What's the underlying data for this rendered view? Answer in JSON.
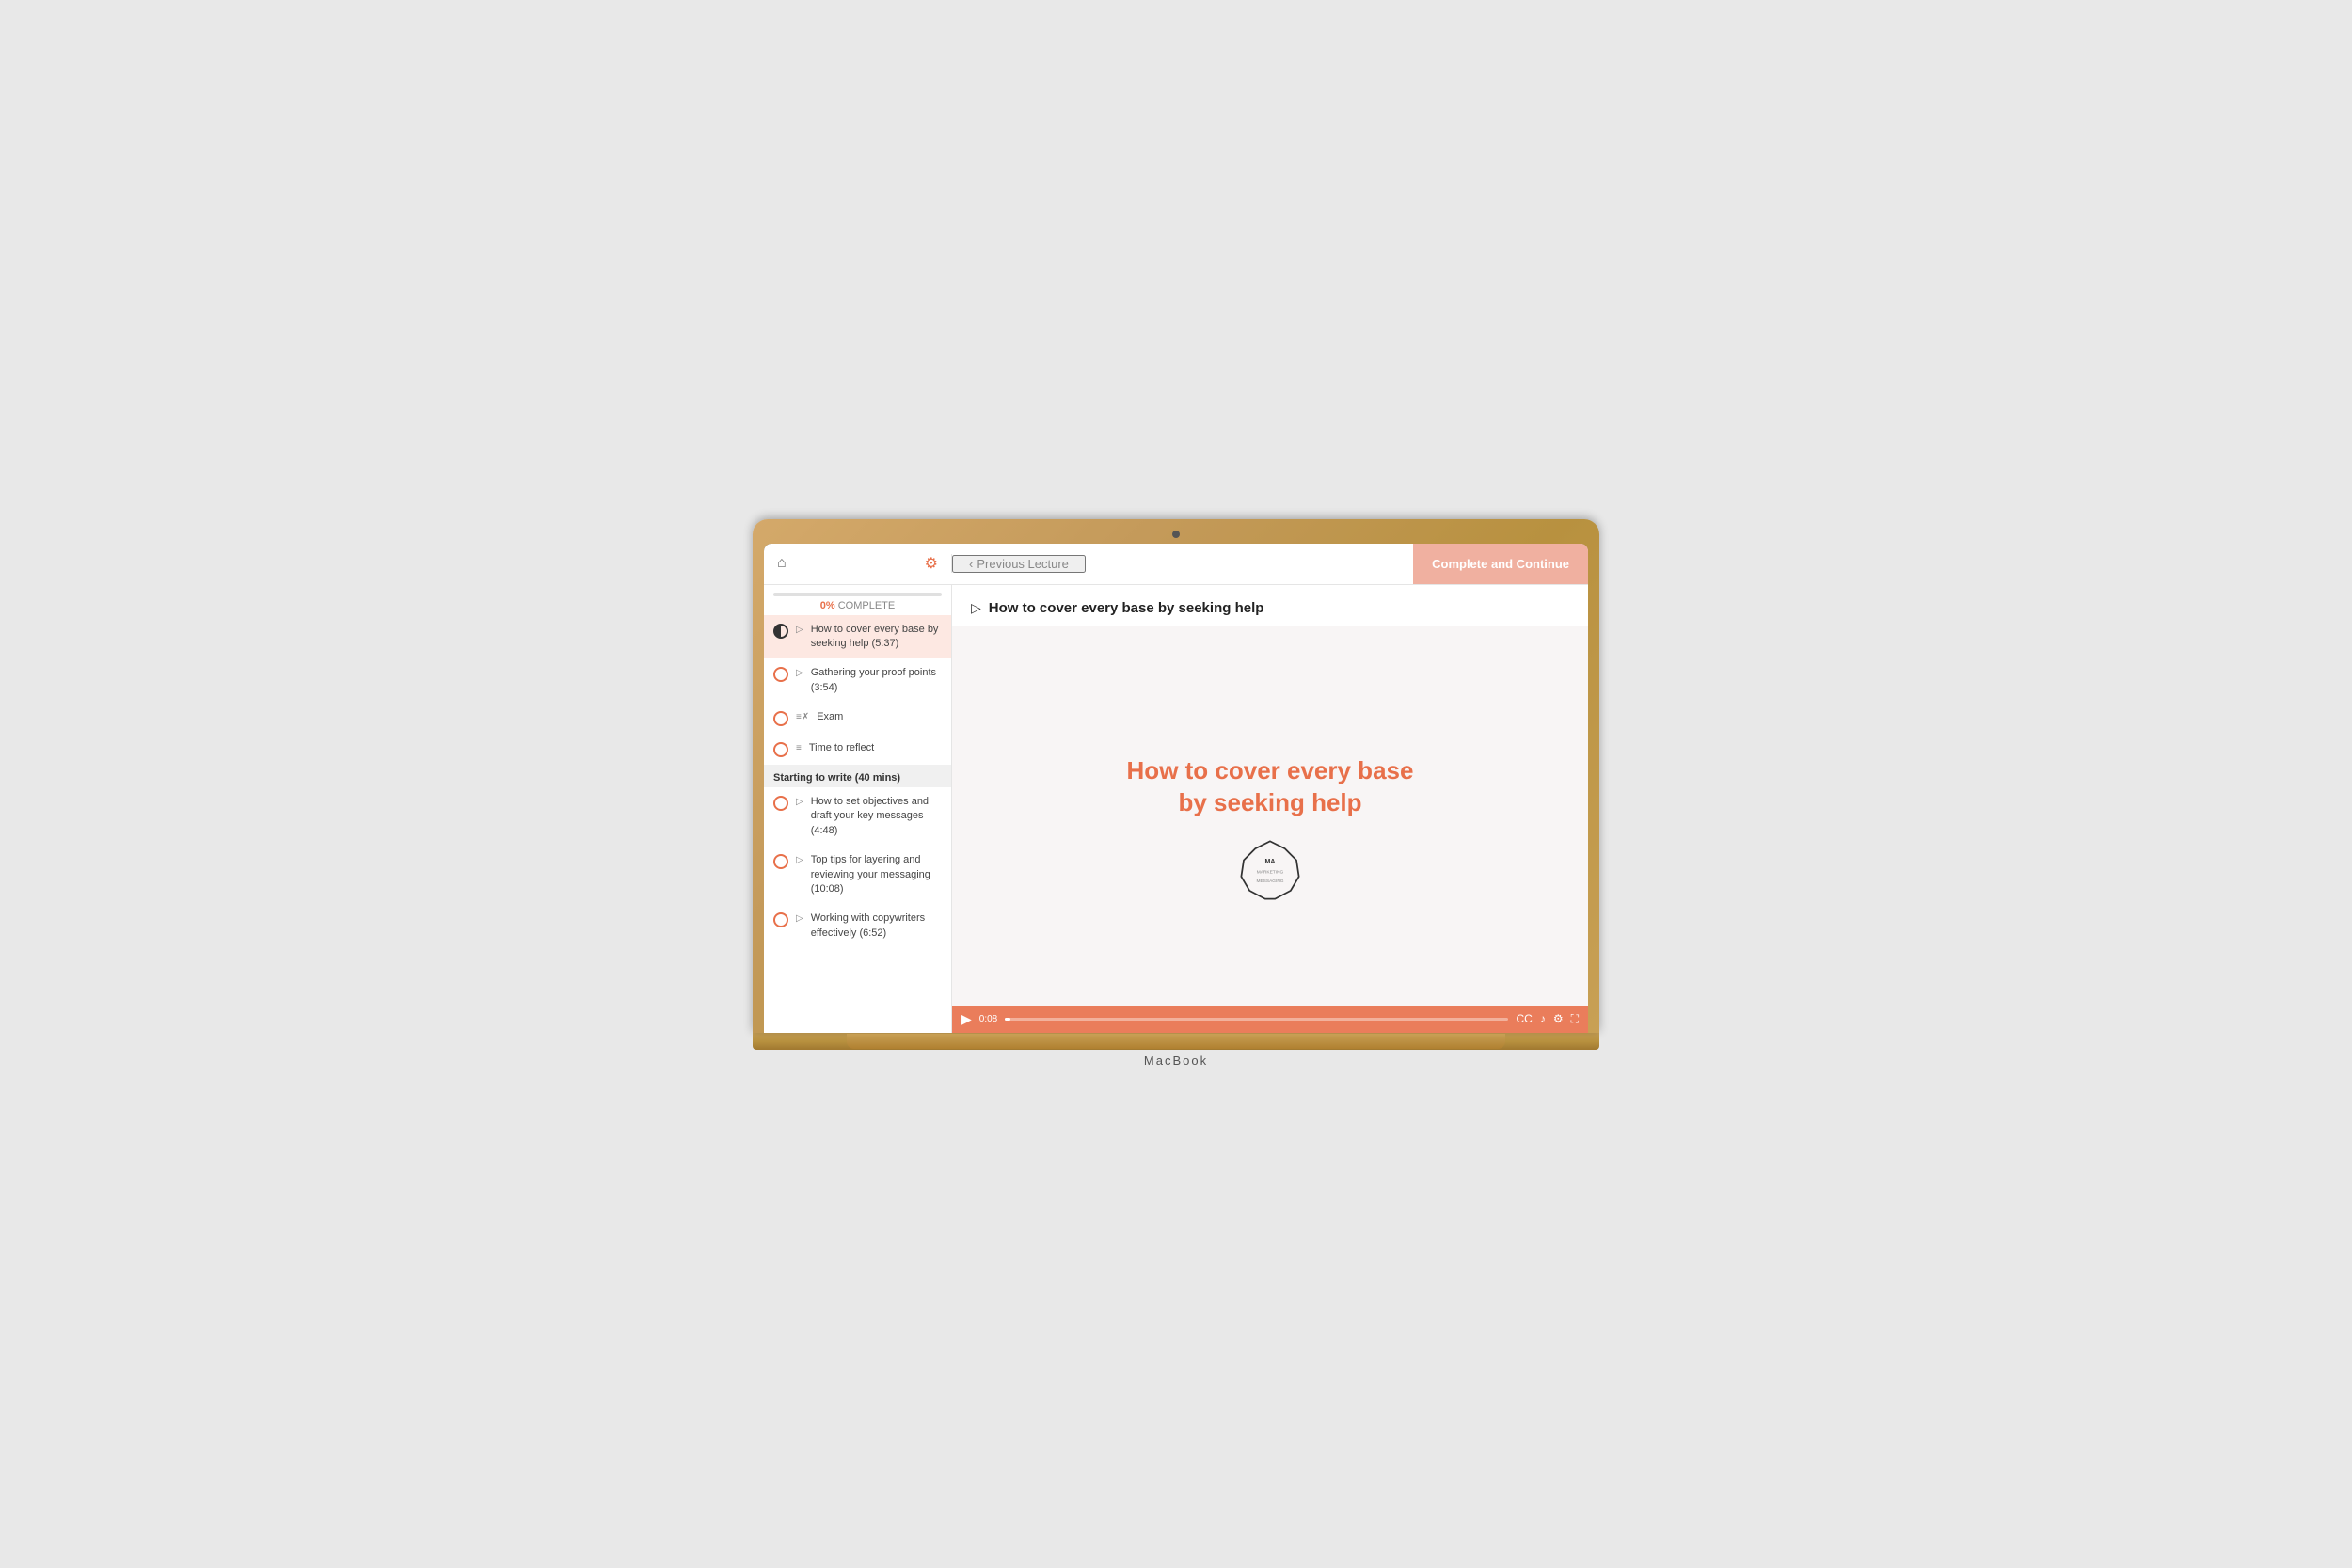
{
  "header": {
    "prev_lecture_label": "Previous Lecture",
    "complete_continue_label": "Complete and Continue"
  },
  "progress": {
    "percentage": "0%",
    "label": "COMPLETE"
  },
  "sidebar": {
    "items": [
      {
        "id": "item-1",
        "icon": "video",
        "text": "How to cover every base by seeking help (5:37)",
        "active": true,
        "circle_type": "half"
      },
      {
        "id": "item-2",
        "icon": "video",
        "text": "Gathering your proof points (3:54)",
        "active": false,
        "circle_type": "empty"
      },
      {
        "id": "item-3",
        "icon": "exam",
        "text": "Exam",
        "active": false,
        "circle_type": "empty"
      },
      {
        "id": "item-4",
        "icon": "text",
        "text": "Time to reflect",
        "active": false,
        "circle_type": "empty"
      }
    ],
    "section_title": "Starting to write (40 mins)",
    "section_items": [
      {
        "id": "section-item-1",
        "icon": "video",
        "text": "How to set objectives and draft your key messages (4:48)",
        "circle_type": "empty"
      },
      {
        "id": "section-item-2",
        "icon": "video",
        "text": "Top tips for layering and reviewing your messaging (10:08)",
        "circle_type": "empty"
      },
      {
        "id": "section-item-3",
        "icon": "video",
        "text": "Working with copywriters effectively (6:52)",
        "circle_type": "empty"
      }
    ]
  },
  "content": {
    "title": "How to cover every base by seeking help",
    "video_title_line1": "How to cover every base",
    "video_title_line2": "by seeking help",
    "time_current": "0:08",
    "badge_text": "MA\nMARKETING\nMESSAGING"
  }
}
